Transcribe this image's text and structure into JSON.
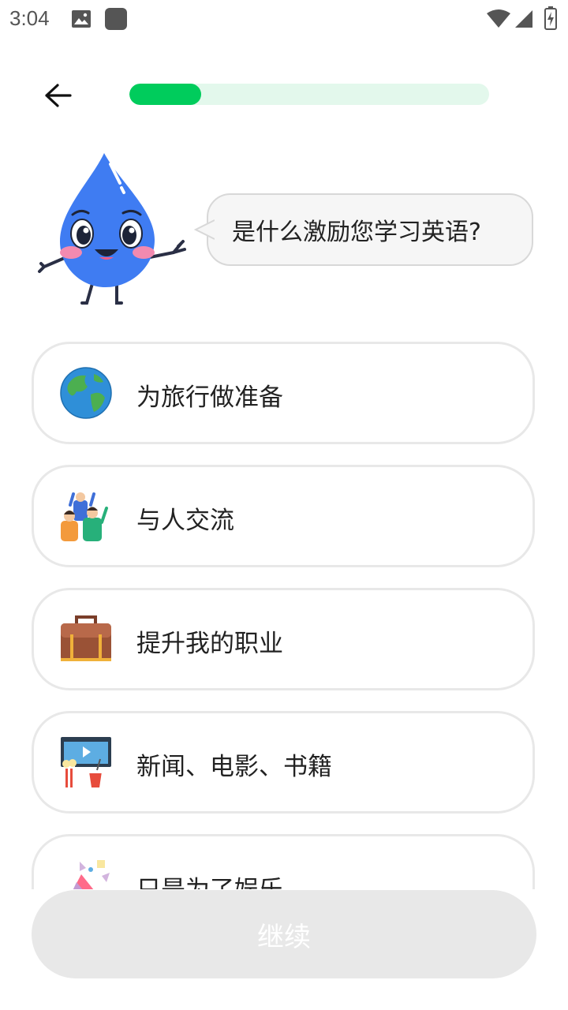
{
  "status_bar": {
    "time": "3:04"
  },
  "header": {
    "progress_fraction": 0.2
  },
  "prompt": {
    "question": "是什么激励您学习英语?"
  },
  "options": [
    {
      "label": "为旅行做准备",
      "icon": "globe-icon"
    },
    {
      "label": "与人交流",
      "icon": "people-icon"
    },
    {
      "label": "提升我的职业",
      "icon": "briefcase-icon"
    },
    {
      "label": "新闻、电影、书籍",
      "icon": "movie-icon"
    },
    {
      "label": "只是为了娱乐",
      "icon": "party-icon"
    }
  ],
  "footer": {
    "continue_label": "继续"
  },
  "colors": {
    "accent_green": "#00cc5c",
    "track_green": "#e3f8ec",
    "mascot_blue": "#3f7cf2",
    "disabled_button": "#e8e8e8"
  }
}
